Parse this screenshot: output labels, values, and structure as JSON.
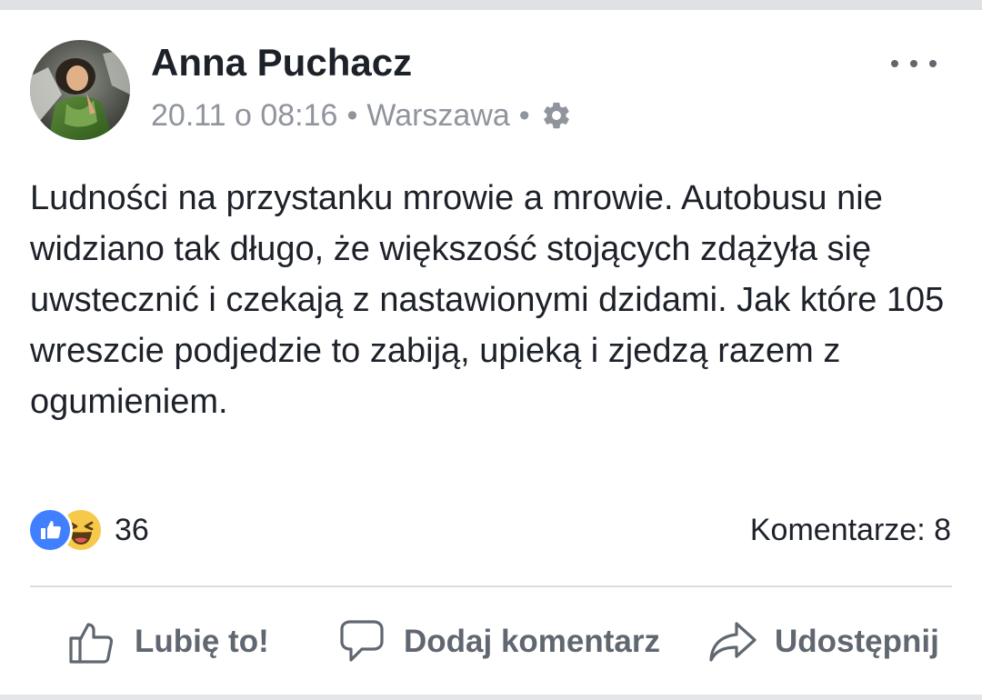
{
  "post": {
    "author": "Anna Puchacz",
    "timestamp": "20.11 o 08:16",
    "separator": "•",
    "location": "Warszawa",
    "privacy_icon": "gear-icon",
    "more_icon": "more-dots-icon",
    "text": "Ludności na przystanku mrowie a mrowie. Autobusu nie widziano tak długo, że większość stojących zdążyła się uwstecznić i czekają z nastawionymi dzidami. Jak które 105 wreszcie podjedzie to zabiją, upieką i zjedzą razem z ogumieniem."
  },
  "reactions": {
    "icons": [
      "like-reaction-icon",
      "haha-reaction-icon"
    ],
    "count": "36",
    "comments_label": "Komentarze: 8"
  },
  "actions": {
    "like_label": "Lubię to!",
    "comment_label": "Dodaj komentarz",
    "share_label": "Udostępnij"
  },
  "colors": {
    "text": "#1d2129",
    "secondary": "#90949c",
    "action": "#606770",
    "like_blue": "#4080ff",
    "haha_yellow": "#f7c94a"
  }
}
